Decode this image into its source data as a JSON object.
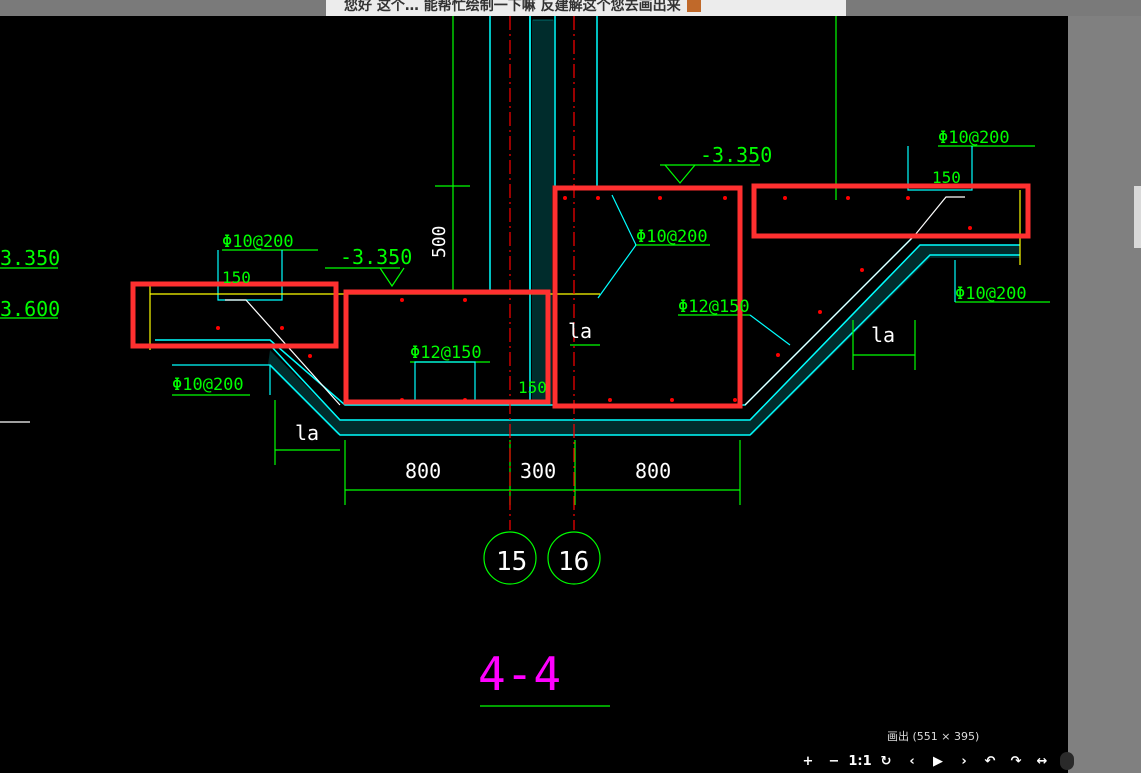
{
  "top_text": "您好 这个… 能帮忙绘制一下嘛 反建解这个您去画出来",
  "drawing": {
    "title": "4-4",
    "elevations": [
      "-3.350",
      "-3.350",
      "3.350",
      "3.600"
    ],
    "rebar_labels": [
      "Φ10@200",
      "Φ10@200",
      "Φ10@200",
      "Φ10@200",
      "Φ10@200",
      "Φ12@150",
      "Φ12@150"
    ],
    "dims": [
      "800",
      "300",
      "800",
      "150",
      "150",
      "150",
      "500"
    ],
    "la_labels": [
      "la",
      "la",
      "la"
    ],
    "axis_markers": [
      "15",
      "16"
    ]
  },
  "image_info": "画出 (551 × 395)",
  "toolbar": {
    "zoom_in": "+",
    "zoom_out": "−",
    "actual": "1:1",
    "rotate": "↻",
    "prev": "‹",
    "play": "▶",
    "next": "›",
    "undo": "↶",
    "redo": "↷",
    "fit_width": "↔",
    "fit_height": "↕"
  },
  "colors": {
    "cad_green": "#00ff00",
    "cad_cyan": "#00ffff",
    "cad_red": "#ff0000",
    "highlight_red": "#ff3030",
    "title_magenta": "#ff00ff"
  }
}
